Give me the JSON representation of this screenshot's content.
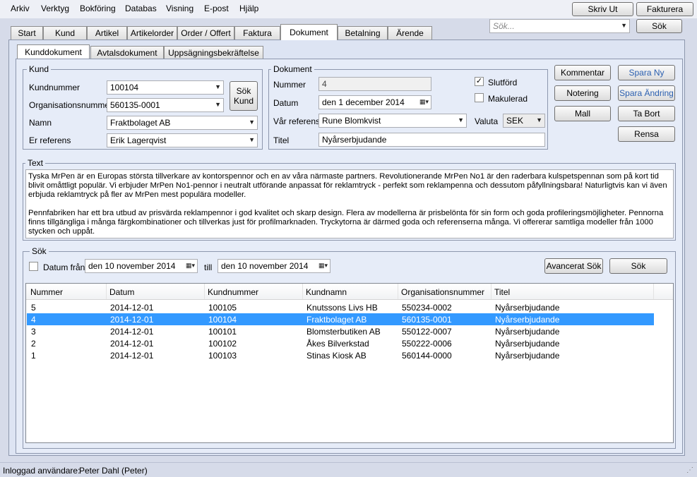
{
  "menu": [
    "Arkiv",
    "Verktyg",
    "Bokföring",
    "Databas",
    "Visning",
    "E-post",
    "Hjälp"
  ],
  "toolbar": {
    "print_label": "Skriv Ut",
    "invoice_label": "Fakturera",
    "search_placeholder": "Sök...",
    "search_label": "Sök"
  },
  "tabs": [
    "Start",
    "Kund",
    "Artikel",
    "Artikelorder",
    "Order / Offert",
    "Faktura",
    "Dokument",
    "Betalning",
    "Ärende"
  ],
  "subtabs": [
    "Kunddokument",
    "Avtalsdokument",
    "Uppsägningsbekräftelse"
  ],
  "kund": {
    "title": "Kund",
    "kundnummer_label": "Kundnummer",
    "kundnummer": "100104",
    "orgnr_label": "Organisationsnummer",
    "orgnr": "560135-0001",
    "namn_label": "Namn",
    "namn": "Fraktbolaget AB",
    "erref_label": "Er referens",
    "erref": "Erik Lagerqvist",
    "search_label_1": "Sök",
    "search_label_2": "Kund"
  },
  "dokument": {
    "title": "Dokument",
    "nummer_label": "Nummer",
    "nummer": "4",
    "datum_label": "Datum",
    "datum": "den   1 december 2014",
    "varref_label": "Vår referens",
    "varref": "Rune Blomkvist",
    "titel_label": "Titel",
    "titel": "Nyårserbjudande",
    "slutford_label": "Slutförd",
    "slutford_checked": "✓",
    "makulerad_label": "Makulerad",
    "valuta_label": "Valuta",
    "valuta": "SEK"
  },
  "actions": {
    "kommentar": "Kommentar",
    "spara_ny": "Spara Ny",
    "notering": "Notering",
    "spara_andring": "Spara Ändring",
    "mall": "Mall",
    "ta_bort": "Ta Bort",
    "rensa": "Rensa"
  },
  "text": {
    "title": "Text",
    "p1": "Tyska MrPen är en Europas största tillverkare av kontorspennor och en av våra närmaste partners. Revolutionerande MrPen No1 är den raderbara kulspetspennan som på kort tid blivit omåttligt populär. Vi erbjuder MrPen No1-pennor  i neutralt utförande anpassat för reklamtryck - perfekt som reklampenna och dessutom påfyllningsbara! Naturligtvis kan vi även erbjuda reklamtryck på fler av MrPen mest populära modeller.",
    "p2": "Pennfabriken har ett bra utbud av prisvärda reklampennor i god kvalitet och skarp design. Flera av modellerna är prisbelönta för sin form och goda profileringsmöjligheter. Pennorna finns tillgängliga i många färgkombinationer och tillverkas just för profilmarknaden. Tryckytorna är därmed goda och referenserna många. Vi offererar samtliga modeller från 1000 stycken och uppåt."
  },
  "sok": {
    "title": "Sök",
    "datum_fran_label": "Datum från",
    "from_date": "den 10 november 2014",
    "till_label": "till",
    "to_date": "den 10 november 2014",
    "advanced_label": "Avancerat Sök",
    "search_label": "Sök"
  },
  "grid": {
    "headers": [
      "Nummer",
      "Datum",
      "Kundnummer",
      "Kundnamn",
      "Organisationsnummer",
      "Titel"
    ],
    "rows": [
      [
        "5",
        "2014-12-01",
        "100105",
        "Knutssons Livs HB",
        "550234-0002",
        "Nyårserbjudande"
      ],
      [
        "4",
        "2014-12-01",
        "100104",
        "Fraktbolaget AB",
        "560135-0001",
        "Nyårserbjudande"
      ],
      [
        "3",
        "2014-12-01",
        "100101",
        "Blomsterbutiken AB",
        "550122-0007",
        "Nyårserbjudande"
      ],
      [
        "2",
        "2014-12-01",
        "100102",
        "Åkes Bilverkstad",
        "550222-0006",
        "Nyårserbjudande"
      ],
      [
        "1",
        "2014-12-01",
        "100103",
        "Stinas Kiosk AB",
        "560144-0000",
        "Nyårserbjudande"
      ]
    ]
  },
  "status": {
    "label": "Inloggad användare:",
    "user": "Peter Dahl (Peter)"
  },
  "colors": {
    "selected_row": "#3399ff",
    "background": "#d6dbe9",
    "link_button_text": "#2a5fb0"
  }
}
